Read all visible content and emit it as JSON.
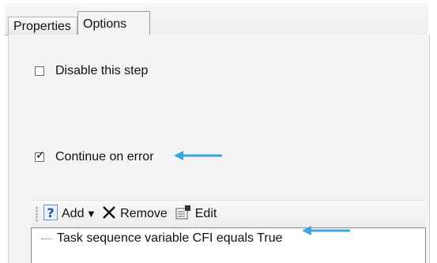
{
  "tabs": [
    {
      "label": "Properties",
      "active": false
    },
    {
      "label": "Options",
      "active": true
    }
  ],
  "options": {
    "disable_step": {
      "label": "Disable this step",
      "checked": false
    },
    "continue_on_error": {
      "label": "Continue on error",
      "checked": true
    }
  },
  "toolbar": {
    "add_label": "Add",
    "remove_label": "Remove",
    "edit_label": "Edit"
  },
  "conditions": [
    {
      "text": "Task sequence variable CFI equals True"
    }
  ],
  "colors": {
    "annotation_arrow": "#3aa6df",
    "panel_background": "#f4f4f4"
  },
  "icons": {
    "add": "help-question-icon",
    "remove": "remove-x-icon",
    "edit": "edit-properties-icon",
    "annotation": "blue-arrow-icon"
  }
}
